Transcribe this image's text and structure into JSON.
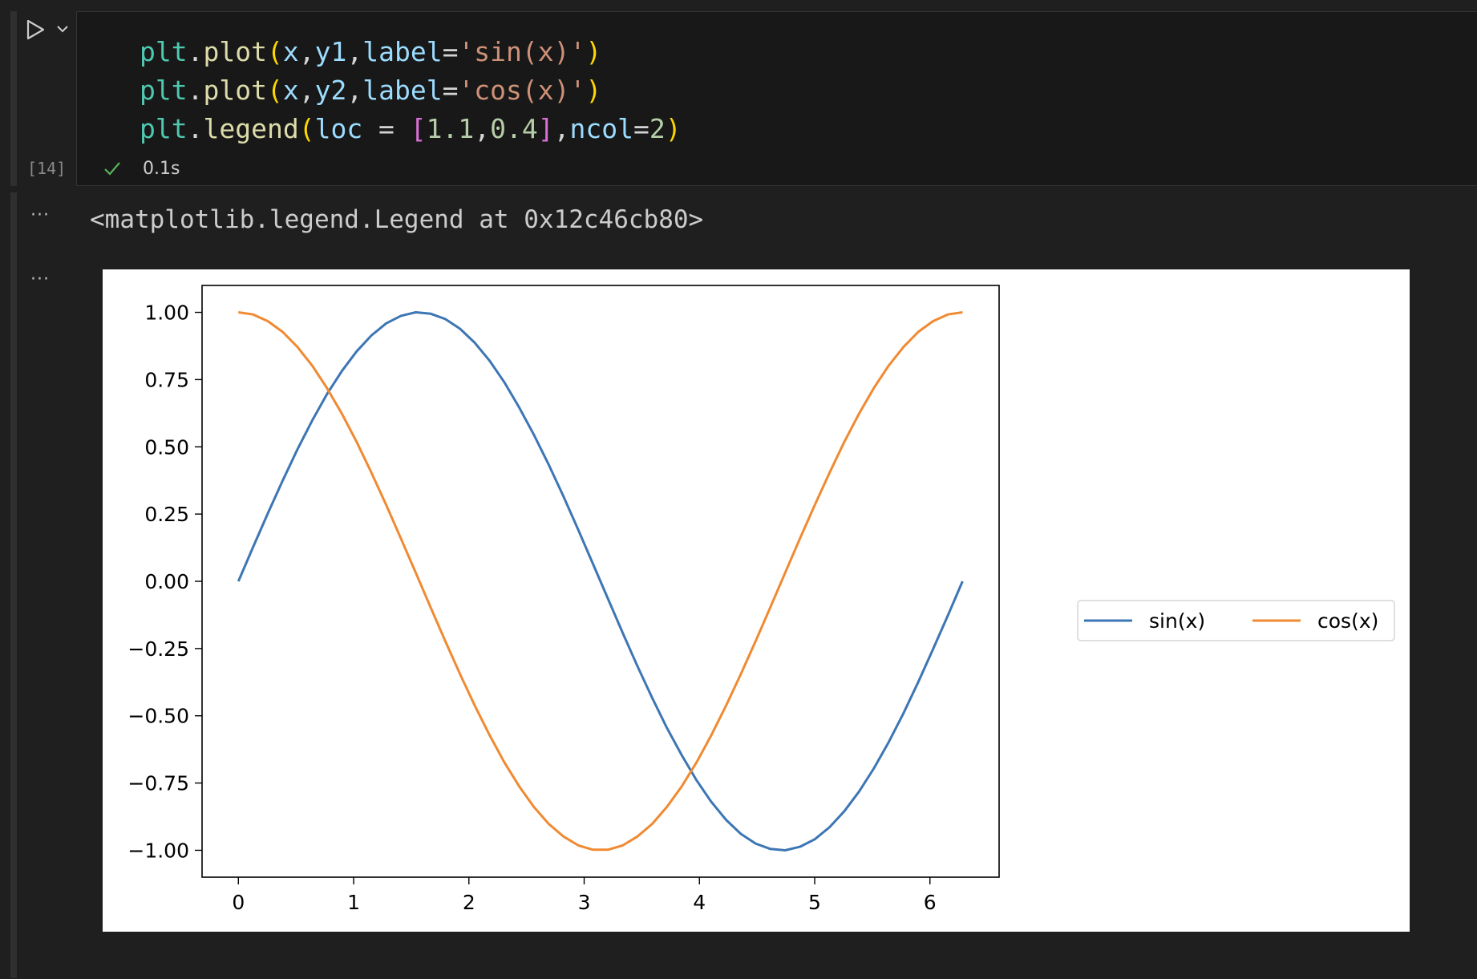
{
  "cell": {
    "execution_count": "[14]",
    "status_time": "0.1s",
    "code_lines": [
      [
        {
          "t": "plt",
          "c": "t-mod"
        },
        {
          "t": ".",
          "c": "t-op"
        },
        {
          "t": "plot",
          "c": "t-fn"
        },
        {
          "t": "(",
          "c": "t-p1"
        },
        {
          "t": "x",
          "c": "t-var"
        },
        {
          "t": ",",
          "c": "t-op"
        },
        {
          "t": "y1",
          "c": "t-var"
        },
        {
          "t": ",",
          "c": "t-op"
        },
        {
          "t": "label",
          "c": "t-var"
        },
        {
          "t": "=",
          "c": "t-op"
        },
        {
          "t": "'sin(x)'",
          "c": "t-str"
        },
        {
          "t": ")",
          "c": "t-p1"
        }
      ],
      [
        {
          "t": "plt",
          "c": "t-mod"
        },
        {
          "t": ".",
          "c": "t-op"
        },
        {
          "t": "plot",
          "c": "t-fn"
        },
        {
          "t": "(",
          "c": "t-p1"
        },
        {
          "t": "x",
          "c": "t-var"
        },
        {
          "t": ",",
          "c": "t-op"
        },
        {
          "t": "y2",
          "c": "t-var"
        },
        {
          "t": ",",
          "c": "t-op"
        },
        {
          "t": "label",
          "c": "t-var"
        },
        {
          "t": "=",
          "c": "t-op"
        },
        {
          "t": "'cos(x)'",
          "c": "t-str"
        },
        {
          "t": ")",
          "c": "t-p1"
        }
      ],
      [
        {
          "t": "plt",
          "c": "t-mod"
        },
        {
          "t": ".",
          "c": "t-op"
        },
        {
          "t": "legend",
          "c": "t-fn"
        },
        {
          "t": "(",
          "c": "t-p1"
        },
        {
          "t": "loc",
          "c": "t-var"
        },
        {
          "t": " = ",
          "c": "t-op"
        },
        {
          "t": "[",
          "c": "t-p2"
        },
        {
          "t": "1.1",
          "c": "t-num"
        },
        {
          "t": ",",
          "c": "t-op"
        },
        {
          "t": "0.4",
          "c": "t-num"
        },
        {
          "t": "]",
          "c": "t-p2"
        },
        {
          "t": ",",
          "c": "t-op"
        },
        {
          "t": "ncol",
          "c": "t-var"
        },
        {
          "t": "=",
          "c": "t-op"
        },
        {
          "t": "2",
          "c": "t-num"
        },
        {
          "t": ")",
          "c": "t-p1"
        }
      ]
    ]
  },
  "output": {
    "text": "<matplotlib.legend.Legend at 0x12c46cb80>",
    "dots": "···"
  },
  "colors": {
    "series_sin": "#3d76b4",
    "series_cos": "#f08a32",
    "status_ok": "#57b35a"
  },
  "chart_data": {
    "type": "line",
    "title": "",
    "xlabel": "",
    "ylabel": "",
    "xlim": [
      -0.315,
      6.6
    ],
    "ylim": [
      -1.1,
      1.1
    ],
    "xticks": [
      0,
      1,
      2,
      3,
      4,
      5,
      6
    ],
    "xtick_labels": [
      "0",
      "1",
      "2",
      "3",
      "4",
      "5",
      "6"
    ],
    "yticks": [
      1.0,
      0.75,
      0.5,
      0.25,
      0.0,
      -0.25,
      -0.5,
      -0.75,
      -1.0
    ],
    "ytick_labels": [
      "1.00",
      "0.75",
      "0.50",
      "0.25",
      "0.00",
      "−0.25",
      "−0.50",
      "−0.75",
      "−1.00"
    ],
    "grid": false,
    "legend": {
      "placement": "outside-right",
      "ncol": 2
    },
    "x": [
      0,
      0.128,
      0.256,
      0.385,
      0.513,
      0.641,
      0.769,
      0.898,
      1.026,
      1.154,
      1.282,
      1.41,
      1.539,
      1.667,
      1.795,
      1.923,
      2.051,
      2.18,
      2.308,
      2.436,
      2.564,
      2.693,
      2.821,
      2.949,
      3.077,
      3.206,
      3.334,
      3.462,
      3.59,
      3.718,
      3.847,
      3.975,
      4.103,
      4.231,
      4.359,
      4.488,
      4.616,
      4.744,
      4.872,
      5.001,
      5.129,
      5.257,
      5.385,
      5.513,
      5.642,
      5.77,
      5.898,
      6.026,
      6.155,
      6.283
    ],
    "series": [
      {
        "name": "sin(x)",
        "values": [
          0,
          0.128,
          0.253,
          0.375,
          0.491,
          0.598,
          0.696,
          0.782,
          0.855,
          0.914,
          0.959,
          0.987,
          1.0,
          0.995,
          0.975,
          0.939,
          0.887,
          0.82,
          0.74,
          0.647,
          0.545,
          0.433,
          0.315,
          0.191,
          0.064,
          -0.064,
          -0.191,
          -0.315,
          -0.433,
          -0.545,
          -0.647,
          -0.74,
          -0.82,
          -0.887,
          -0.939,
          -0.975,
          -0.995,
          -1.0,
          -0.987,
          -0.959,
          -0.914,
          -0.855,
          -0.782,
          -0.696,
          -0.598,
          -0.491,
          -0.375,
          -0.253,
          -0.128,
          0
        ]
      },
      {
        "name": "cos(x)",
        "values": [
          1.0,
          0.992,
          0.967,
          0.927,
          0.871,
          0.802,
          0.718,
          0.623,
          0.518,
          0.404,
          0.284,
          0.159,
          0.032,
          -0.096,
          -0.222,
          -0.345,
          -0.462,
          -0.572,
          -0.673,
          -0.762,
          -0.839,
          -0.902,
          -0.949,
          -0.982,
          -0.998,
          -0.998,
          -0.982,
          -0.949,
          -0.902,
          -0.839,
          -0.762,
          -0.673,
          -0.572,
          -0.462,
          -0.345,
          -0.222,
          -0.096,
          0.032,
          0.159,
          0.284,
          0.404,
          0.518,
          0.623,
          0.718,
          0.802,
          0.871,
          0.927,
          0.967,
          0.992,
          1.0
        ]
      }
    ]
  }
}
